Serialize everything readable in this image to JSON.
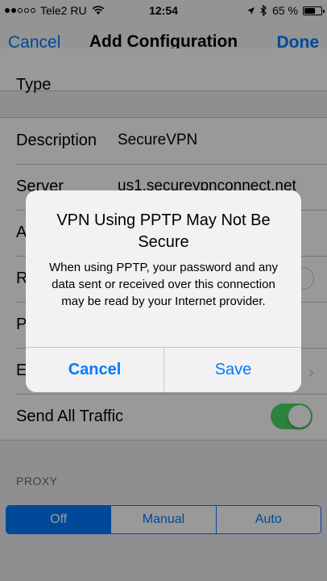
{
  "status": {
    "carrier": "Tele2 RU",
    "time": "12:54",
    "battery": "65 %",
    "battery_level": 0.65,
    "icons": [
      "signal-dots-icon",
      "wifi-icon",
      "location-arrow-icon",
      "bluetooth-icon",
      "battery-icon"
    ]
  },
  "nav": {
    "cancel": "Cancel",
    "title": "Add Configuration",
    "done": "Done"
  },
  "rows": {
    "partial": "Type",
    "description_label": "Description",
    "description_value": "SecureVPN",
    "server_label": "Server",
    "server_value": "us1.securevpnconnect.net",
    "row3": "A",
    "row4": "R",
    "row5": "P",
    "row6": "E",
    "send_all_traffic": "Send All Traffic",
    "send_all_traffic_on": true
  },
  "proxy": {
    "header": "PROXY",
    "options": [
      "Off",
      "Manual",
      "Auto"
    ],
    "selected": "Off"
  },
  "alert": {
    "title": "VPN Using PPTP May Not Be Secure",
    "message": "When using PPTP, your password and any data sent or received over this connection may be read by your Internet provider.",
    "cancel": "Cancel",
    "save": "Save"
  },
  "colors": {
    "accent": "#007aff",
    "toggle_on": "#4cd964"
  }
}
